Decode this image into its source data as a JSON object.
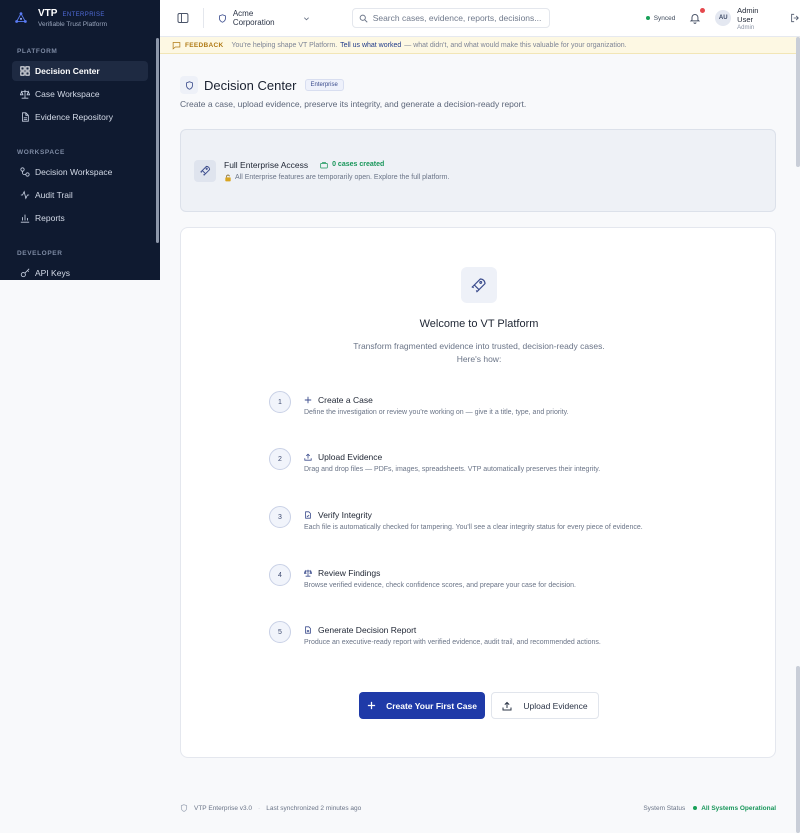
{
  "brand": {
    "name": "VTP",
    "badge": "ENTERPRISE",
    "subtitle": "Verifiable Trust Platform"
  },
  "sidebar": {
    "sections": [
      {
        "label": "PLATFORM",
        "items": [
          {
            "label": "Decision Center",
            "icon": "grid-icon",
            "active": true
          },
          {
            "label": "Case Workspace",
            "icon": "scale-icon"
          },
          {
            "label": "Evidence Repository",
            "icon": "file-icon"
          }
        ]
      },
      {
        "label": "WORKSPACE",
        "items": [
          {
            "label": "Decision Workspace",
            "icon": "workflow-icon"
          },
          {
            "label": "Audit Trail",
            "icon": "activity-icon"
          },
          {
            "label": "Reports",
            "icon": "bar-chart-icon"
          }
        ]
      },
      {
        "label": "DEVELOPER",
        "items": [
          {
            "label": "API Keys",
            "icon": "key-icon"
          }
        ]
      }
    ]
  },
  "topbar": {
    "org": "Acme Corporation",
    "search_placeholder": "Search cases, evidence, reports, decisions...",
    "sync_status": "Synced",
    "avatar_initials": "AU",
    "user_name": "Admin User",
    "user_role": "Admin"
  },
  "feedback": {
    "label": "FEEDBACK",
    "text_before": "You're helping shape VT Platform.",
    "link": "Tell us what worked",
    "text_after": "— what didn't, and what would make this valuable for your organization."
  },
  "page": {
    "title": "Decision Center",
    "badge": "Enterprise",
    "subtitle": "Create a case, upload evidence, preserve its integrity, and generate a decision-ready report."
  },
  "access": {
    "title": "Full Enterprise Access",
    "count": "0 cases created",
    "desc": "All Enterprise features are temporarily open. Explore the full platform."
  },
  "welcome": {
    "title": "Welcome to VT Platform",
    "subtitle": "Transform fragmented evidence into trusted, decision-ready cases. Here's how:"
  },
  "steps": [
    {
      "num": "1",
      "title": "Create a Case",
      "desc": "Define the investigation or review you're working on — give it a title, type, and priority."
    },
    {
      "num": "2",
      "title": "Upload Evidence",
      "desc": "Drag and drop files — PDFs, images, spreadsheets. VTP automatically preserves their integrity."
    },
    {
      "num": "3",
      "title": "Verify Integrity",
      "desc": "Each file is automatically checked for tampering. You'll see a clear integrity status for every piece of evidence."
    },
    {
      "num": "4",
      "title": "Review Findings",
      "desc": "Browse verified evidence, check confidence scores, and prepare your case for decision."
    },
    {
      "num": "5",
      "title": "Generate Decision Report",
      "desc": "Produce an executive-ready report with verified evidence, audit trail, and recommended actions."
    }
  ],
  "actions": {
    "primary": "Create Your First Case",
    "secondary": "Upload Evidence"
  },
  "footer": {
    "version": "VTP Enterprise v3.0",
    "sync": "Last synchronized 2 minutes ago",
    "status_label": "System Status",
    "status_value": "All Systems Operational"
  },
  "colors": {
    "sidebar_bg": "#0f1a30",
    "primary": "#1f3aa8",
    "success": "#18a058",
    "warning_bg": "#fdf8e3"
  }
}
